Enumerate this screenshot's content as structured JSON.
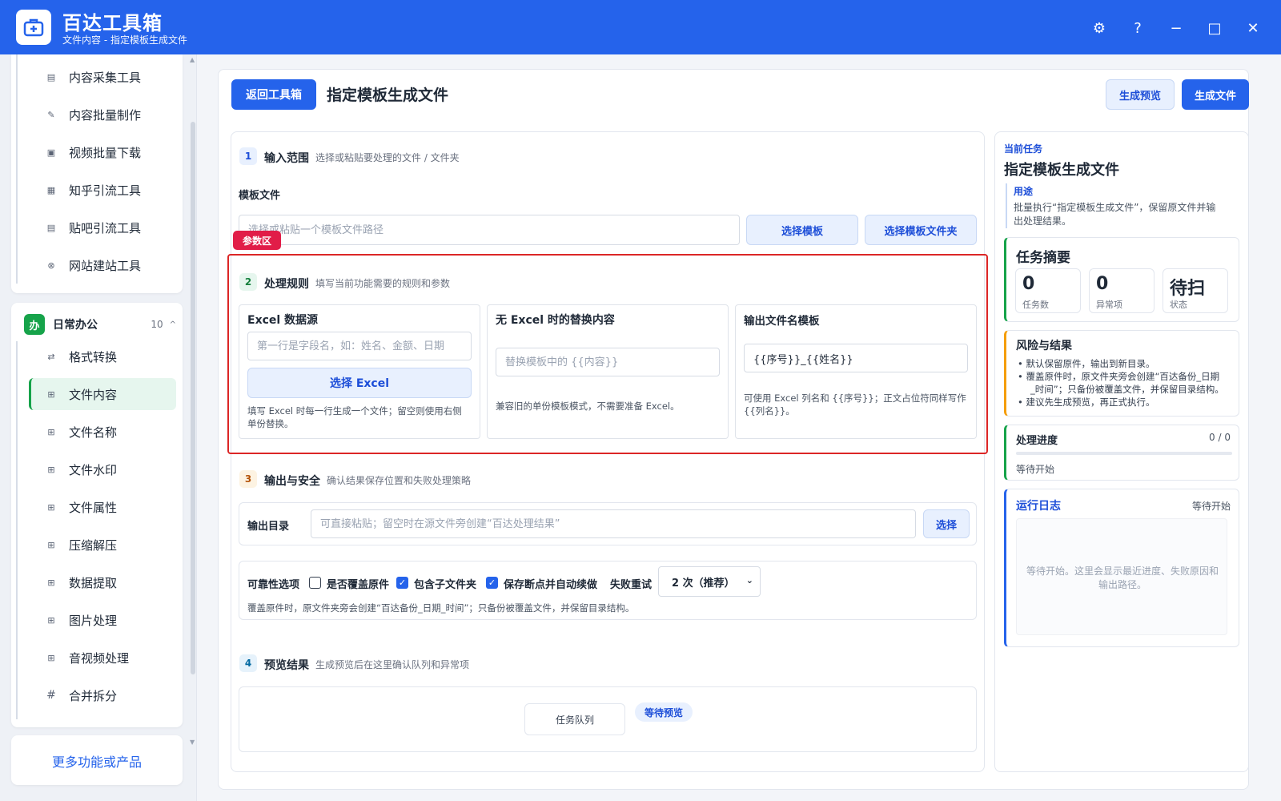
{
  "app": {
    "title": "百达工具箱",
    "subtitle": "文件内容 - 指定模板生成文件"
  },
  "window_controls": {
    "settings": "⚙",
    "help": "?",
    "minimize": "−",
    "maximize": "□",
    "close": "✕"
  },
  "sidebar": {
    "top_items": [
      {
        "label": "内容采集工具",
        "icon": "collect-icon"
      },
      {
        "label": "内容批量制作",
        "icon": "pen-icon"
      },
      {
        "label": "视频批量下载",
        "icon": "video-icon"
      },
      {
        "label": "知乎引流工具",
        "icon": "zhihu-icon"
      },
      {
        "label": "贴吧引流工具",
        "icon": "tieba-icon"
      },
      {
        "label": "网站建站工具",
        "icon": "site-icon"
      }
    ],
    "group": {
      "icon_text": "办",
      "label": "日常办公",
      "count": "10",
      "caret": "^"
    },
    "group_items": [
      {
        "label": "格式转换",
        "icon": "convert-icon"
      },
      {
        "label": "文件内容",
        "icon": "grid-icon"
      },
      {
        "label": "文件名称",
        "icon": "grid-icon"
      },
      {
        "label": "文件水印",
        "icon": "grid-icon"
      },
      {
        "label": "文件属性",
        "icon": "grid-icon"
      },
      {
        "label": "压缩解压",
        "icon": "grid-icon"
      },
      {
        "label": "数据提取",
        "icon": "grid-icon"
      },
      {
        "label": "图片处理",
        "icon": "grid-icon"
      },
      {
        "label": "音视频处理",
        "icon": "grid-icon"
      },
      {
        "label": "合并拆分",
        "icon": "hash-icon"
      }
    ],
    "active_index": 1,
    "more": "更多功能或产品"
  },
  "header": {
    "back": "返回工具箱",
    "title": "指定模板生成文件",
    "preview": "生成预览",
    "generate": "生成文件"
  },
  "section1": {
    "num": "1",
    "title": "输入范围",
    "desc": "选择或粘贴要处理的文件 / 文件夹",
    "field_label": "模板文件",
    "placeholder": "选择或粘贴一个模板文件路径",
    "btn_template": "选择模板",
    "btn_folder": "选择模板文件夹"
  },
  "param_tag": "参数区",
  "section2": {
    "num": "2",
    "title": "处理规则",
    "desc": "填写当前功能需要的规则和参数",
    "excel": {
      "title": "Excel 数据源",
      "placeholder": "第一行是字段名，如：姓名、金额、日期",
      "button": "选择 Excel",
      "hint_line1": "填写 Excel 时每一行生成一个文件；留空则使用右侧",
      "hint_line2": "单份替换。"
    },
    "noexcel": {
      "title": "无 Excel 时的替换内容",
      "placeholder": "替换模板中的 {{内容}}",
      "hint": "兼容旧的单份模板模式，不需要准备 Excel。"
    },
    "filename": {
      "title": "输出文件名模板",
      "value": "{{序号}}_{{姓名}}",
      "hint_line1": "可使用 Excel 列名和 {{序号}}；正文占位符同样写作",
      "hint_line2": "{{列名}}。"
    }
  },
  "section3": {
    "num": "3",
    "title": "输出与安全",
    "desc": "确认结果保存位置和失败处理策略",
    "out_label": "输出目录",
    "out_placeholder": "可直接粘贴；留空时在源文件旁创建“百达处理结果”",
    "out_btn": "选择",
    "reliability_label": "可靠性选项",
    "options": [
      {
        "label": "是否覆盖原件",
        "checked": false
      },
      {
        "label": "包含子文件夹",
        "checked": true
      },
      {
        "label": "保存断点并自动续做",
        "checked": true
      }
    ],
    "retry_label": "失败重试",
    "retry_value": "2 次（推荐）",
    "note": "覆盖原件时，原文件夹旁会创建“百达备份_日期_时间”；只备份被覆盖文件，并保留目录结构。"
  },
  "section4": {
    "num": "4",
    "title": "预览结果",
    "desc": "生成预览后在这里确认队列和异常项",
    "queue": "任务队列",
    "badge": "等待预览"
  },
  "right": {
    "kicker": "当前任务",
    "title": "指定模板生成文件",
    "usage_label": "用途",
    "usage_line1": "批量执行“指定模板生成文件”，保留原文件并输",
    "usage_line2": "出处理结果。",
    "summary_title": "任务摘要",
    "stats": [
      {
        "value": "0",
        "label": "任务数"
      },
      {
        "value": "0",
        "label": "异常项"
      },
      {
        "value": "待扫",
        "label": "状态"
      }
    ],
    "risk_title": "风险与结果",
    "risk_items": [
      "默认保留原件，输出到新目录。",
      "覆盖原件时，原文件夹旁会创建“百达备份_日期",
      "_时间”；只备份被覆盖文件，并保留目录结构。",
      "建议先生成预览，再正式执行。"
    ],
    "progress_title": "处理进度",
    "progress_count": "0 / 0",
    "progress_fraction": 0,
    "progress_status": "等待开始",
    "log_title": "运行日志",
    "log_status": "等待开始",
    "log_line1": "等待开始。这里会显示最近进度、失败原因和",
    "log_line2": "输出路径。"
  },
  "colors": {
    "accent": "#2563eb",
    "active_green": "#16a34a",
    "param_red": "#dc2626",
    "risk_orange": "#f59e0b"
  }
}
